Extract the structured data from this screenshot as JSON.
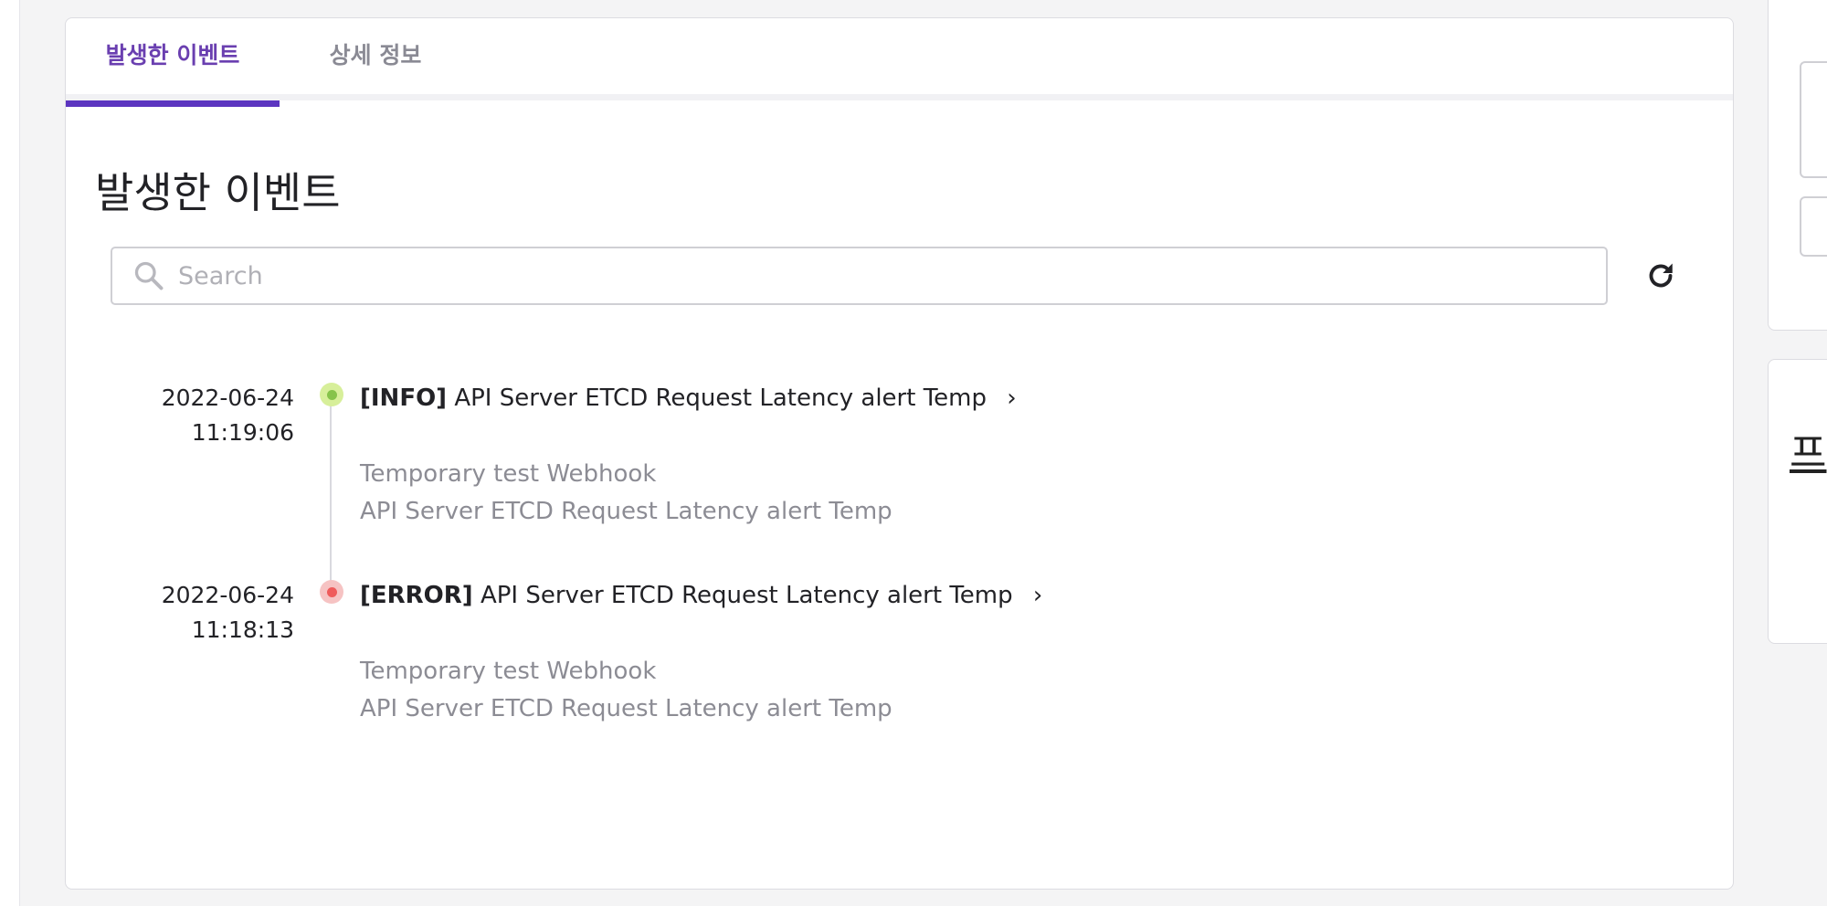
{
  "tabs": [
    {
      "label": "발생한 이벤트",
      "active": true
    },
    {
      "label": "상세 정보",
      "active": false
    }
  ],
  "section_title": "발생한 이벤트",
  "search": {
    "placeholder": "Search",
    "value": ""
  },
  "events": [
    {
      "date": "2022-06-24",
      "time": "11:19:06",
      "level": "[INFO]",
      "title": "API Server ETCD Request Latency alert Temp",
      "desc_line1": "Temporary test Webhook",
      "desc_line2": "API Server ETCD Request Latency alert Temp",
      "status_color": "#86c34a",
      "status_ring": "#d7ef9a"
    },
    {
      "date": "2022-06-24",
      "time": "11:18:13",
      "level": "[ERROR]",
      "title": "API Server ETCD Request Latency alert Temp",
      "desc_line1": "Temporary test Webhook",
      "desc_line2": "API Server ETCD Request Latency alert Temp",
      "status_color": "#ef5b5b",
      "status_ring": "#f6c3c3"
    }
  ],
  "right_panel": {
    "heading_fragment": "프"
  },
  "icons": {
    "search": "search-icon",
    "refresh": "refresh-icon",
    "chevron": "chevron-right-icon"
  },
  "colors": {
    "accent": "#5c35c0",
    "tab_active_text": "#6a3fb0"
  }
}
